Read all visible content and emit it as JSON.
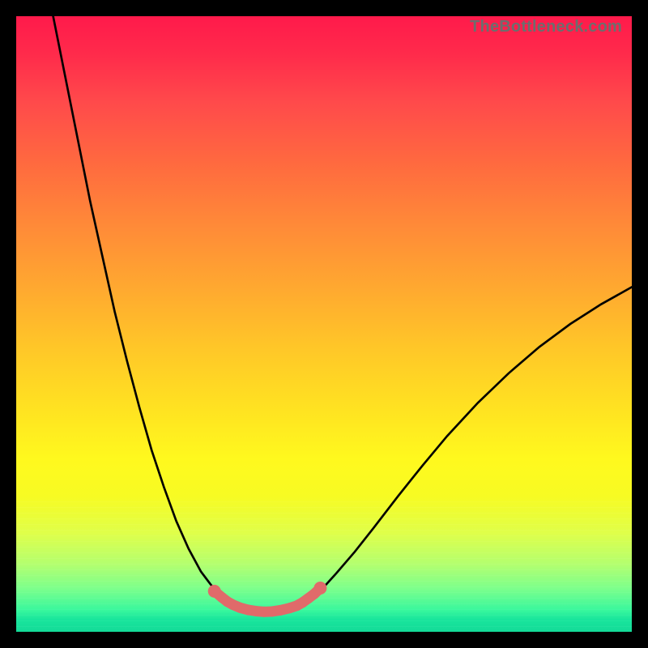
{
  "watermark": {
    "text": "TheBottleneck.com"
  },
  "colors": {
    "curve_stroke": "#000000",
    "highlight_stroke": "#e06a6a",
    "frame": "#000000"
  },
  "chart_data": {
    "type": "line",
    "title": "",
    "xlabel": "",
    "ylabel": "",
    "xlim": [
      0,
      100
    ],
    "ylim": [
      0,
      100
    ],
    "grid": false,
    "legend": false,
    "series": [
      {
        "name": "left-branch",
        "x": [
          6,
          8,
          10,
          12,
          14,
          16,
          18,
          20,
          22,
          24,
          26,
          28,
          30,
          31.5,
          33,
          34,
          34.8
        ],
        "y": [
          100,
          90,
          80,
          70,
          61,
          52,
          44,
          36.5,
          29.5,
          23.5,
          18,
          13.5,
          9.8,
          7.8,
          6.0,
          5.0,
          4.5
        ]
      },
      {
        "name": "basin",
        "x": [
          34.8,
          36,
          37.5,
          39,
          40.5,
          42,
          43.5,
          45,
          46,
          46.8
        ],
        "y": [
          4.5,
          3.9,
          3.5,
          3.3,
          3.2,
          3.3,
          3.5,
          3.9,
          4.3,
          4.7
        ]
      },
      {
        "name": "right-branch",
        "x": [
          46.8,
          48,
          50,
          52,
          55,
          58,
          62,
          66,
          70,
          75,
          80,
          85,
          90,
          95,
          100
        ],
        "y": [
          4.7,
          5.5,
          7.3,
          9.5,
          13,
          16.8,
          22,
          27,
          31.8,
          37.2,
          42,
          46.3,
          50,
          53.2,
          56
        ]
      }
    ],
    "highlight": {
      "name": "optimal-range",
      "x": [
        32.2,
        33.4,
        34.3,
        35.2,
        36.4,
        37.7,
        39.0,
        40.3,
        41.6,
        42.9,
        44.4,
        45.6,
        46.5,
        47.4,
        48.4,
        49.4
      ],
      "y": [
        6.6,
        5.6,
        4.9,
        4.4,
        3.9,
        3.55,
        3.35,
        3.25,
        3.3,
        3.5,
        3.85,
        4.25,
        4.75,
        5.4,
        6.15,
        7.1
      ]
    }
  }
}
